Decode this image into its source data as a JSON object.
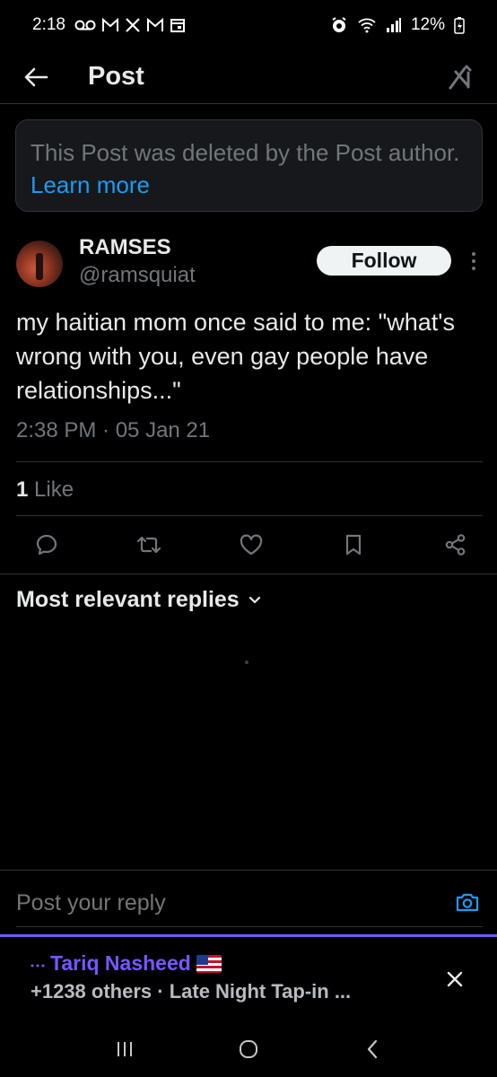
{
  "status_bar": {
    "time": "2:18",
    "notification_icons": [
      "voicemail-icon",
      "gmail-icon",
      "x-icon",
      "gmail-icon",
      "calendar-icon"
    ],
    "battery": "12%",
    "right_icons": [
      "alarm-icon",
      "wifi-icon",
      "signal-icon",
      "battery-icon"
    ]
  },
  "header": {
    "title": "Post",
    "back_icon": "arrow-left-icon",
    "grok_icon": "grok-icon"
  },
  "deleted_notice": {
    "text": "This Post was deleted by the Post author.",
    "link": "Learn more"
  },
  "author": {
    "name": "RAMSES",
    "handle": "@ramsquiat",
    "follow_label": "Follow"
  },
  "tweet": {
    "text": "my haitian mom once said to me: \"what's wrong with you, even gay people have relationships...\"",
    "timestamp": "2:38 PM · 05 Jan 21"
  },
  "stats": {
    "likes_count": "1",
    "likes_label": "Like"
  },
  "actions": [
    "reply-icon",
    "retweet-icon",
    "like-icon",
    "bookmark-icon",
    "share-icon"
  ],
  "replies": {
    "sort_label": "Most relevant replies"
  },
  "reply_bar": {
    "placeholder": "Post your reply"
  },
  "space_bar": {
    "host": "Tariq Nasheed",
    "subtitle": "+1238 others · Late Night Tap-in ...",
    "accent": "#7856ff"
  },
  "colors": {
    "background": "#000000",
    "link": "#1d9bf0",
    "secondary_text": "#71767b",
    "primary_text": "#e7e9ea"
  }
}
